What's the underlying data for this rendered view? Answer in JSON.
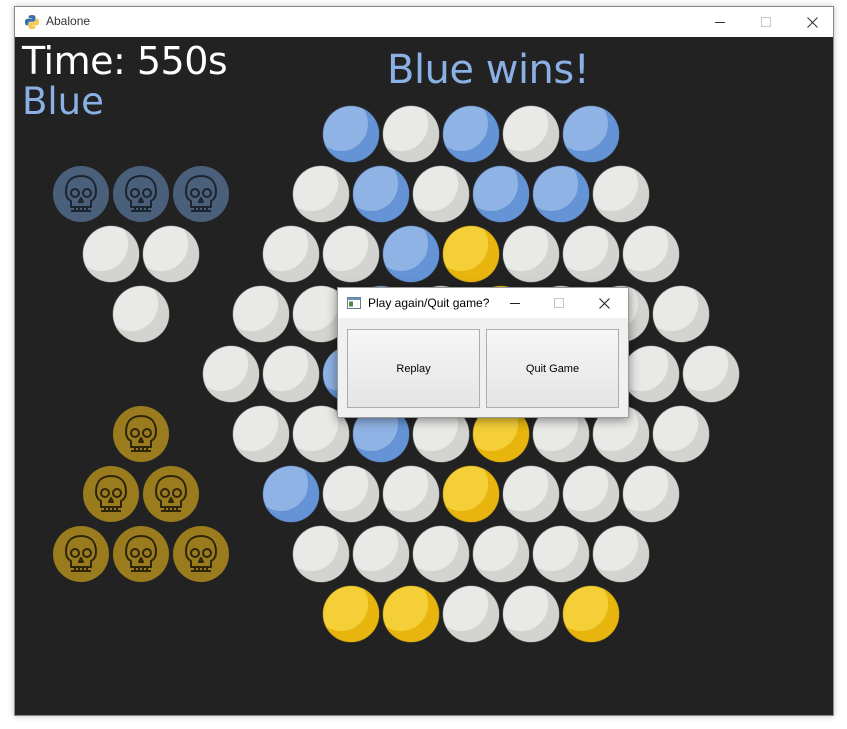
{
  "window": {
    "title": "Abalone",
    "controls": [
      "minimize-icon",
      "maximize-icon",
      "close-icon"
    ]
  },
  "hud": {
    "time": "Time: 550s",
    "current_player": "Blue",
    "message": "Blue wins!"
  },
  "colors": {
    "background": "#222222",
    "blue": "#8fb3e4",
    "gold": "#f5cf37",
    "white": "#e9e9e7",
    "captured_blue": "#4a5f79",
    "captured_gold": "#9a7c1e",
    "text_blue": "#8ab0e6"
  },
  "board": {
    "marble_kinds": [
      "empty",
      "blue",
      "gold"
    ],
    "rows": [
      [
        "blue",
        "empty",
        "blue",
        "empty",
        "blue"
      ],
      [
        "empty",
        "blue",
        "empty",
        "blue",
        "blue",
        "empty"
      ],
      [
        "empty",
        "empty",
        "blue",
        "gold",
        "empty",
        "empty",
        "empty"
      ],
      [
        "empty",
        "empty",
        "blue",
        "empty",
        "gold",
        "empty",
        "empty",
        "empty"
      ],
      [
        "empty",
        "empty",
        "blue",
        "empty",
        "empty",
        "empty",
        "empty",
        "empty",
        "empty"
      ],
      [
        "empty",
        "empty",
        "blue",
        "empty",
        "gold",
        "empty",
        "empty",
        "empty"
      ],
      [
        "blue",
        "empty",
        "empty",
        "gold",
        "empty",
        "empty",
        "empty"
      ],
      [
        "empty",
        "empty",
        "empty",
        "empty",
        "empty",
        "empty"
      ],
      [
        "gold",
        "gold",
        "empty",
        "empty",
        "gold"
      ]
    ]
  },
  "captured": {
    "top_rows": [
      [
        "skull",
        "skull",
        "skull"
      ],
      [
        "empty",
        "empty"
      ],
      [
        "empty"
      ]
    ],
    "bottom_rows": [
      [
        "skull"
      ],
      [
        "skull",
        "skull"
      ],
      [
        "skull",
        "skull",
        "skull"
      ]
    ],
    "icon": "skull-icon"
  },
  "dialog": {
    "title": "Play again/Quit game?",
    "replay_label": "Replay",
    "quit_label": "Quit Game"
  }
}
